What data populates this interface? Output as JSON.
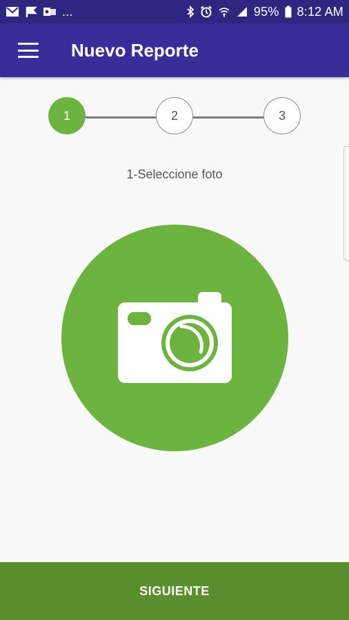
{
  "status_bar": {
    "battery": "95%",
    "time": "8:12 AM",
    "overflow": "...",
    "left_icons": [
      "gmail-icon",
      "flag-icon",
      "outlook-icon"
    ],
    "right_icons": [
      "bluetooth-icon",
      "alarm-icon",
      "wifi-icon",
      "signal-icon",
      "battery-icon"
    ]
  },
  "app_bar": {
    "title": "Nuevo Reporte",
    "menu_icon": "hamburger-menu-icon"
  },
  "stepper": {
    "steps": [
      {
        "label": "1",
        "state": "active"
      },
      {
        "label": "2",
        "state": "inactive"
      },
      {
        "label": "3",
        "state": "inactive"
      }
    ],
    "caption": "1-Seleccione foto"
  },
  "photo_picker": {
    "icon": "camera-icon"
  },
  "footer": {
    "next_label": "SIGUIENTE"
  },
  "colors": {
    "status_bar": "#2f2680",
    "app_bar": "#3a2d99",
    "accent_green": "#6cb33f",
    "footer_green": "#5a8f2e",
    "background": "#f9f9f9"
  }
}
